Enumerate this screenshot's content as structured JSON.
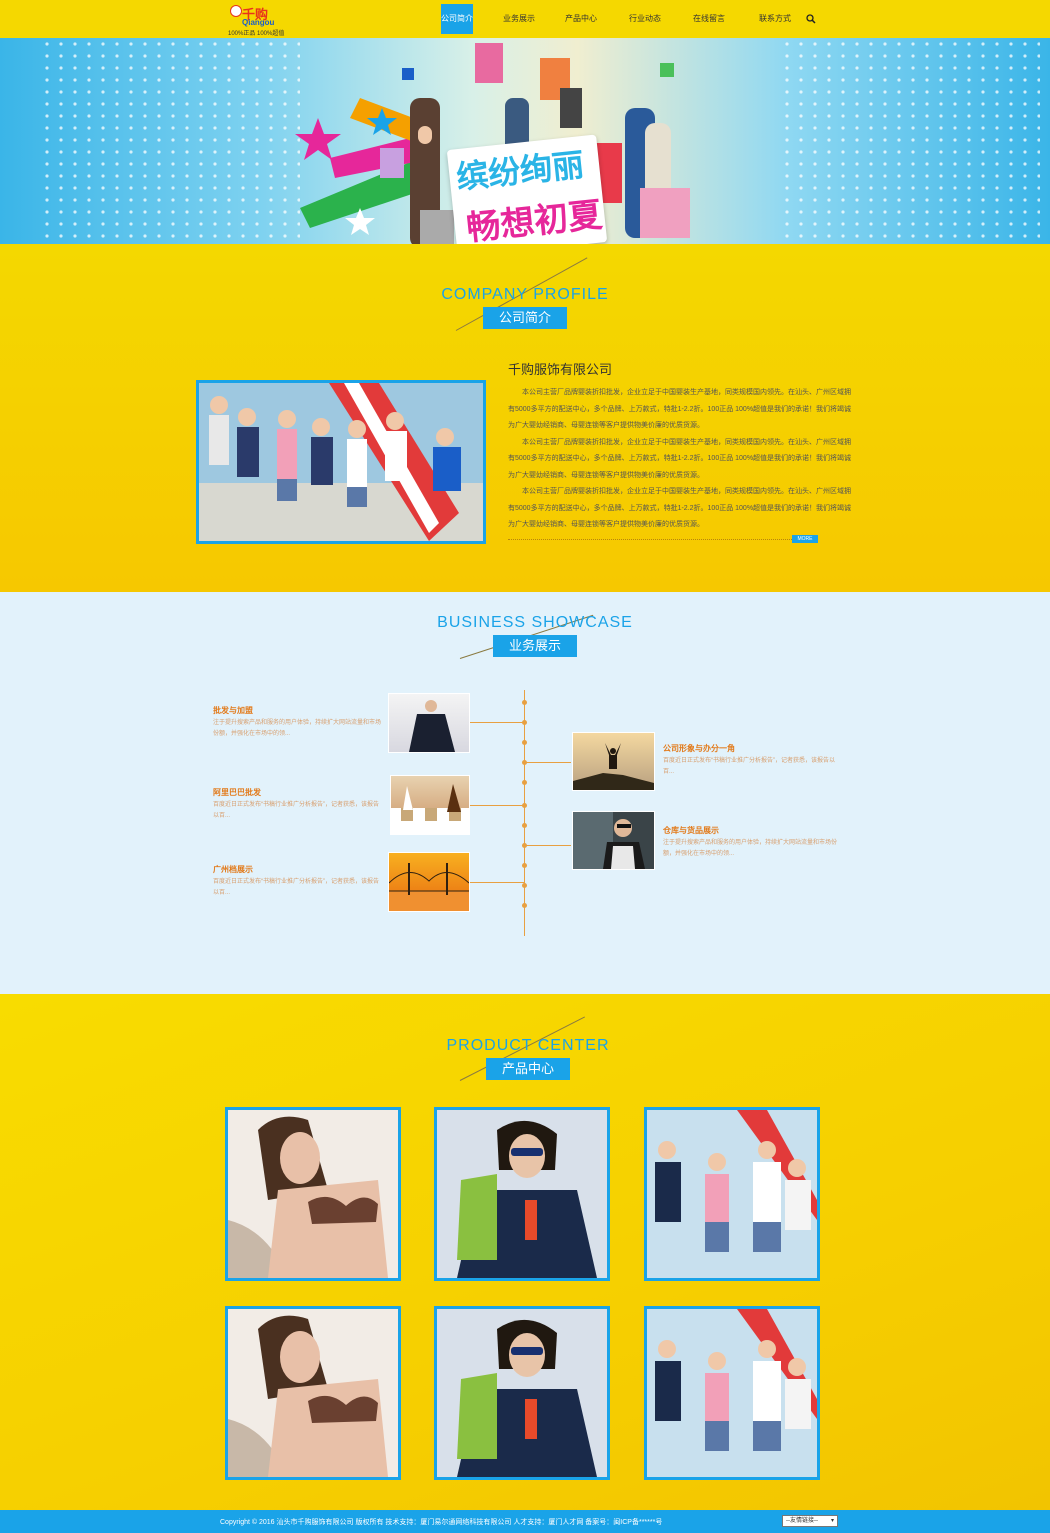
{
  "logo": {
    "cn": "千购",
    "en": "Qiangou",
    "tagline": "100%正品 100%超值"
  },
  "nav": {
    "items": [
      "公司简介",
      "业务展示",
      "产品中心",
      "行业动态",
      "在线留言",
      "联系方式"
    ],
    "active_index": 0
  },
  "banner": {
    "line1": "缤纷绚丽",
    "line2": "畅想初夏"
  },
  "profile": {
    "title_en": "COMPANY PROFILE",
    "title_cn": "公司简介",
    "company": "千购服饰有限公司",
    "paragraphs": [
      "本公司主营厂品牌婴装折扣批发，企业立足于中国婴装生产基地，同类规模国内领先。在汕头、广州区域拥有5000多平方的配送中心，多个品牌、上万款式，特批1-2.2折。100正品 100%超值是我们的承诺！我们将竭诚为广大婴幼经销商、母婴连锁等客户提供物美价廉的优质货源。",
      "本公司主营厂品牌婴装折扣批发，企业立足于中国婴装生产基地，同类规模国内领先。在汕头、广州区域拥有5000多平方的配送中心，多个品牌、上万款式，特批1-2.2折。100正品 100%超值是我们的承诺！我们将竭诚为广大婴幼经销商、母婴连锁等客户提供物美价廉的优质货源。",
      "本公司主营厂品牌婴装折扣批发，企业立足于中国婴装生产基地，同类规模国内领先。在汕头、广州区域拥有5000多平方的配送中心，多个品牌、上万款式，特批1-2.2折。100正品 100%超值是我们的承诺！我们将竭诚为广大婴幼经销商、母婴连锁等客户提供物美价廉的优质货源。"
    ],
    "more": "MORE"
  },
  "business": {
    "title_en": "BUSINESS SHOWCASE",
    "title_cn": "业务展示",
    "left": [
      {
        "title": "批发与加盟",
        "desc": "注于提升搜索产品和服务的用户体验，持续扩大网站流量和市场份额，并强化在市场中的领..."
      },
      {
        "title": "阿里巴巴批发",
        "desc": "百度近日正式发布“书稿行业推广分析报告”，记者获悉，该报告以百..."
      },
      {
        "title": "广州档展示",
        "desc": "百度近日正式发布“书稿行业推广分析报告”，记者获悉，该报告以百..."
      }
    ],
    "right": [
      {
        "title": "公司形象与办分一角",
        "desc": "百度近日正式发布“书稿行业推广分析报告”，记者获悉，该报告以百..."
      },
      {
        "title": "仓库与货品展示",
        "desc": "注于提升搜索产品和服务的用户体验，持续扩大网站流量和市场份额，并强化在市场中的领..."
      }
    ]
  },
  "products": {
    "title_en": "PRODUCT CENTER",
    "title_cn": "产品中心"
  },
  "footer": {
    "copyright": "Copyright © 2016 汕头市千购服饰有限公司 版权所有  技术支持：厦门易尔通网络科技有限公司  人才支持：厦门人才网    备案号：闽ICP备******号",
    "links_select": "--友情链接--"
  },
  "colors": {
    "accent": "#1aa3e8",
    "yellow": "#f5d800",
    "orange": "#e27a1a"
  }
}
